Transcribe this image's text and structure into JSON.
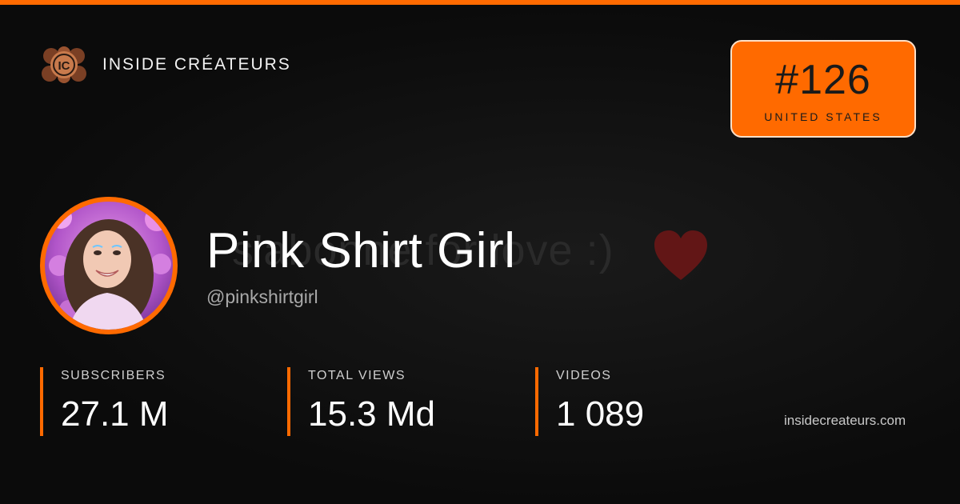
{
  "brand": {
    "name": "INSIDE CRÉATEURS",
    "logo_text": "IC",
    "logo_icon": "ic-logo-icon"
  },
  "rank": {
    "number": "#126",
    "country": "UNITED STATES"
  },
  "channel": {
    "name": "Pink Shirt Girl",
    "handle": "@pinkshirtgirl",
    "avatar_icon": "profile-avatar",
    "banner_text": "s'abonne for love :)",
    "banner_icon": "heart-icon"
  },
  "stats": [
    {
      "label": "SUBSCRIBERS",
      "value": "27.1  M"
    },
    {
      "label": "TOTAL VIEWS",
      "value": "15.3 Md"
    },
    {
      "label": "VIDEOS",
      "value": "1 089"
    }
  ],
  "site": "insidecreateurs.com",
  "colors": {
    "accent": "#ff6a00",
    "background": "#0b0b0b",
    "rank_text": "#1a1a1a"
  }
}
